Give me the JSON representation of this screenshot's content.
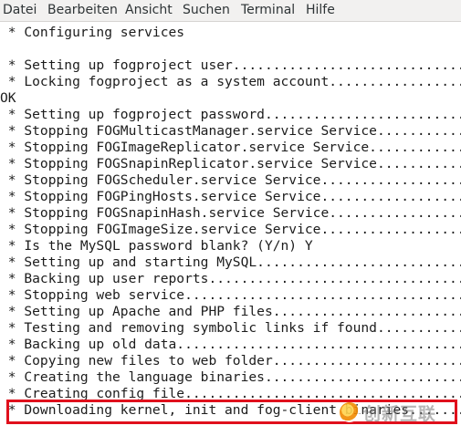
{
  "menubar": {
    "items": [
      "Datei",
      "Bearbeiten",
      "Ansicht",
      "Suchen",
      "Terminal",
      "Hilfe"
    ]
  },
  "terminal": {
    "lines": [
      " * Configuring services",
      "",
      " * Setting up fogproject user.................................",
      " * Locking fogproject as a system account.....................",
      "OK",
      " * Setting up fogproject password.............................",
      " * Stopping FOGMulticastManager.service Service...............",
      " * Stopping FOGImageReplicator.service Service................",
      " * Stopping FOGSnapinReplicator.service Service...............",
      " * Stopping FOGScheduler.service Service......................",
      " * Stopping FOGPingHosts.service Service......................",
      " * Stopping FOGSnapinHash.service Service.....................",
      " * Stopping FOGImageSize.service Service......................",
      " * Is the MySQL password blank? (Y/n) Y",
      " * Setting up and starting MySQL..............................",
      " * Backing up user reports....................................",
      " * Stopping web service.......................................",
      " * Setting up Apache and PHP files............................",
      " * Testing and removing symbolic links if found...............",
      " * Backing up old data........................................",
      " * Copying new files to web folder............................",
      " * Creating the language binaries.............................",
      " * Creating config file.......................................",
      " * Downloading kernel, init and fog-client binaries..........."
    ]
  },
  "watermark": {
    "text": "创新互联"
  },
  "colors": {
    "highlight_border": "#e0101c",
    "terminal_bg": "#ffffff",
    "terminal_fg": "#1c1c1c",
    "menubar_bg": "#f2f1f0"
  }
}
